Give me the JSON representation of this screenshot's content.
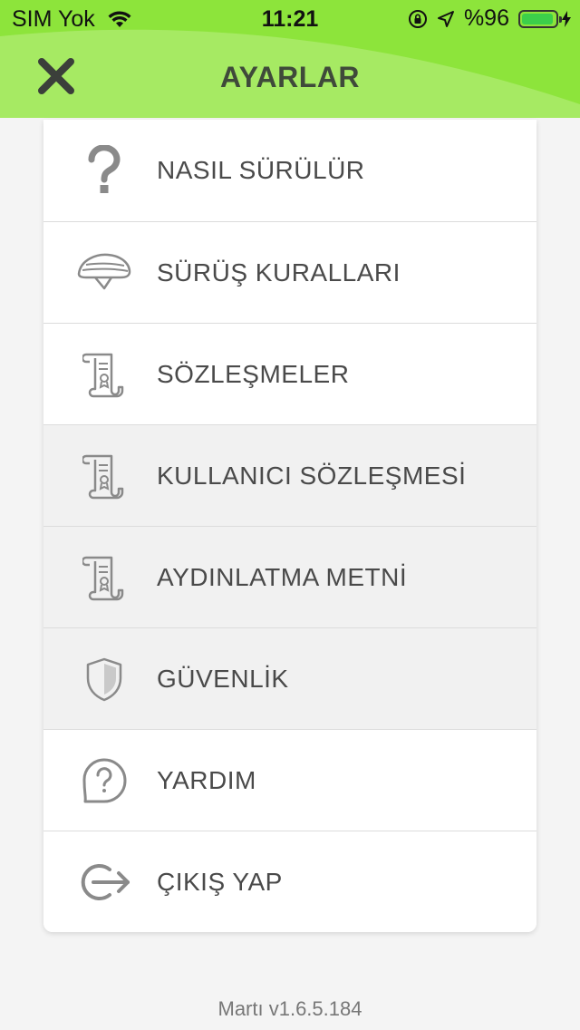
{
  "status_bar": {
    "carrier": "SIM Yok",
    "time": "11:21",
    "battery_text": "%96",
    "battery_level": 0.96
  },
  "header": {
    "title": "AYARLAR",
    "close_icon": "close-icon",
    "accent_color": "#8fe53e"
  },
  "menu": {
    "items": [
      {
        "label": "NASIL SÜRÜLÜR",
        "icon": "question-mark-icon"
      },
      {
        "label": "SÜRÜŞ KURALLARI",
        "icon": "helmet-icon"
      },
      {
        "label": "SÖZLEŞMELER",
        "icon": "document-scroll-icon"
      },
      {
        "label": "KULLANICI SÖZLEŞMESİ",
        "icon": "document-scroll-icon"
      },
      {
        "label": "AYDINLATMA METNİ",
        "icon": "document-scroll-icon"
      },
      {
        "label": "GÜVENLİK",
        "icon": "shield-icon"
      },
      {
        "label": "YARDIM",
        "icon": "help-bubble-icon"
      },
      {
        "label": "ÇIKIŞ YAP",
        "icon": "logout-icon"
      }
    ]
  },
  "footer": {
    "version": "Martı v1.6.5.184"
  }
}
